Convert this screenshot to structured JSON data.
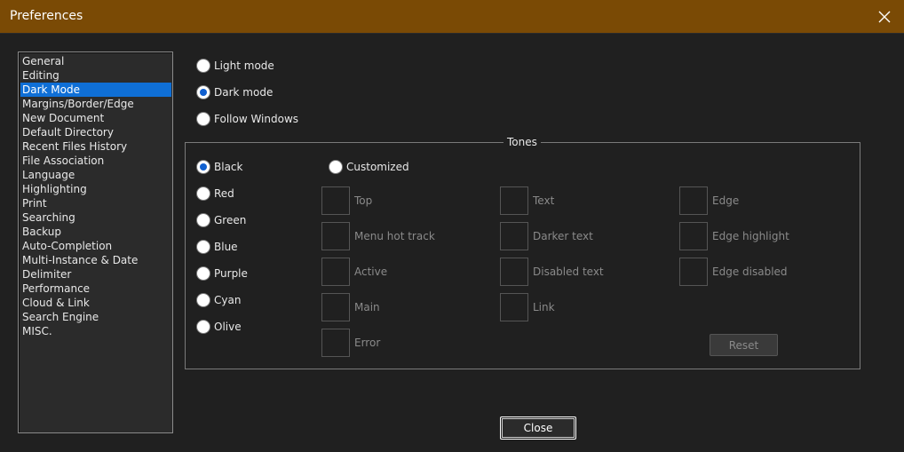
{
  "window": {
    "title": "Preferences",
    "close_button_label": "",
    "titlebar_color": "#7a4a05",
    "accent_color": "#0f6fd6"
  },
  "sidebar": {
    "items": [
      {
        "label": "General"
      },
      {
        "label": "Editing"
      },
      {
        "label": "Dark Mode",
        "selected": true
      },
      {
        "label": "Margins/Border/Edge"
      },
      {
        "label": "New Document"
      },
      {
        "label": "Default Directory"
      },
      {
        "label": "Recent Files History"
      },
      {
        "label": "File Association"
      },
      {
        "label": "Language"
      },
      {
        "label": "Highlighting"
      },
      {
        "label": "Print"
      },
      {
        "label": "Searching"
      },
      {
        "label": "Backup"
      },
      {
        "label": "Auto-Completion"
      },
      {
        "label": "Multi-Instance & Date"
      },
      {
        "label": "Delimiter"
      },
      {
        "label": "Performance"
      },
      {
        "label": "Cloud & Link"
      },
      {
        "label": "Search Engine"
      },
      {
        "label": "MISC."
      }
    ]
  },
  "mode": {
    "light_label": "Light mode",
    "dark_label": "Dark mode",
    "follow_label": "Follow Windows",
    "selected": "dark"
  },
  "tones": {
    "title": "Tones",
    "options": {
      "black": "Black",
      "red": "Red",
      "green": "Green",
      "blue": "Blue",
      "purple": "Purple",
      "cyan": "Cyan",
      "olive": "Olive"
    },
    "selected": "black",
    "customized_label": "Customized",
    "colors": {
      "top": "Top",
      "menu_hot_track": "Menu hot track",
      "active": "Active",
      "main": "Main",
      "error": "Error",
      "text": "Text",
      "darker_text": "Darker text",
      "disabled_text": "Disabled text",
      "link": "Link",
      "edge": "Edge",
      "edge_highlight": "Edge highlight",
      "edge_disabled": "Edge disabled"
    },
    "reset_label": "Reset"
  },
  "footer": {
    "close_label": "Close"
  }
}
